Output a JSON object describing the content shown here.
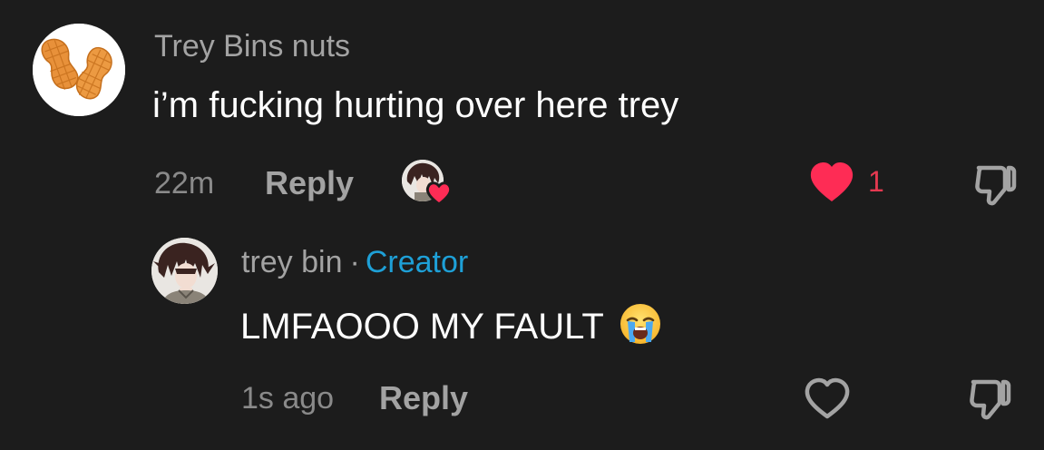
{
  "comments": [
    {
      "username": "Trey Bins nuts",
      "text": "i’m fucking hurting over here trey",
      "time": "22m",
      "reply_label": "Reply",
      "like_count": "1",
      "liked": true,
      "avatar_icon": "peanut-avatar-icon",
      "creator_liked": true
    },
    {
      "username": "trey bin",
      "separator": "·",
      "badge": "Creator",
      "text": "LMFAOOO MY FAULT",
      "emoji": "loudly-crying-face",
      "time": "1s ago",
      "reply_label": "Reply",
      "liked": false,
      "avatar_icon": "anime-character-avatar-icon"
    }
  ],
  "colors": {
    "background": "#1c1c1c",
    "liked_heart": "#fe2c55",
    "creator_badge": "#1ea0d7",
    "muted_text": "#a3a3a3"
  }
}
